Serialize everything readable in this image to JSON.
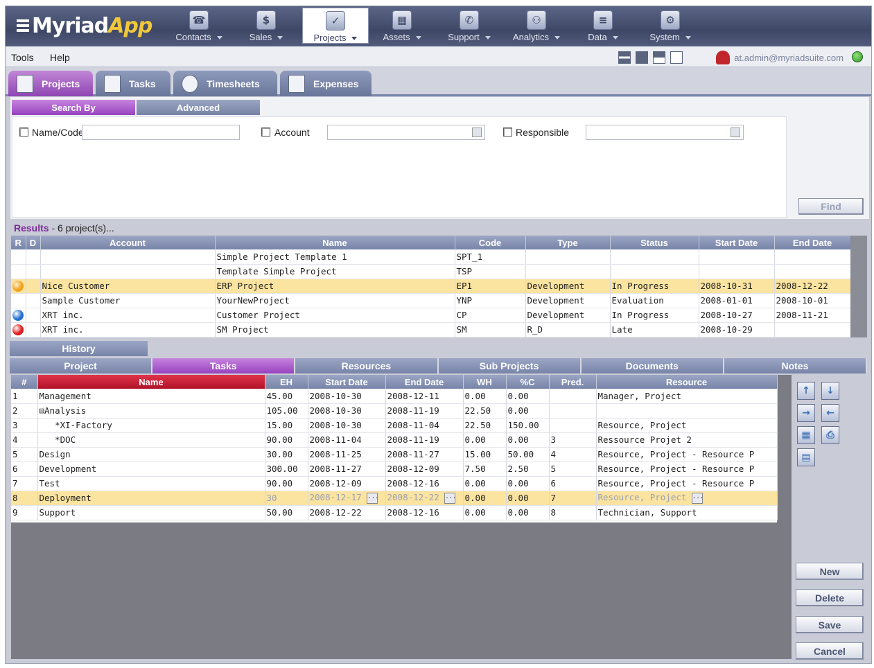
{
  "app": {
    "logo_part1": "Myriad",
    "logo_part2": "App"
  },
  "nav": [
    {
      "label": "Contacts",
      "icon": "contacts-icon",
      "glyph": "☎"
    },
    {
      "label": "Sales",
      "icon": "sales-icon",
      "glyph": "$"
    },
    {
      "label": "Projects",
      "icon": "projects-icon",
      "glyph": "✓"
    },
    {
      "label": "Assets",
      "icon": "assets-icon",
      "glyph": "▦"
    },
    {
      "label": "Support",
      "icon": "support-icon",
      "glyph": "✆"
    },
    {
      "label": "Analytics",
      "icon": "analytics-icon",
      "glyph": "⚇"
    },
    {
      "label": "Data",
      "icon": "data-icon",
      "glyph": "≡"
    },
    {
      "label": "System",
      "icon": "system-icon",
      "glyph": "⚙"
    }
  ],
  "menu": {
    "tools": "Tools",
    "help": "Help"
  },
  "user": {
    "email": "at.admin@myriadsuite.com"
  },
  "module_tabs": [
    "Projects",
    "Tasks",
    "Timesheets",
    "Expenses"
  ],
  "search": {
    "tab_search_by": "Search By",
    "tab_advanced": "Advanced",
    "name_code_label": "Name/Code",
    "account_label": "Account",
    "responsible_label": "Responsible",
    "find_button": "Find"
  },
  "results": {
    "label": "Results",
    "count_text": "6 project(s)...",
    "columns": [
      "R",
      "D",
      "Account",
      "Name",
      "Code",
      "Type",
      "Status",
      "Start Date",
      "End Date"
    ],
    "rows": [
      {
        "status_color": "",
        "account": "",
        "name": "Simple Project Template 1",
        "code": "SPT_1",
        "type": "",
        "status": "",
        "start": "",
        "end": ""
      },
      {
        "status_color": "",
        "account": "",
        "name": "Template Simple Project",
        "code": "TSP",
        "type": "",
        "status": "",
        "start": "",
        "end": ""
      },
      {
        "status_color": "#f0a21c",
        "account": "Nice Customer",
        "name": "ERP Project",
        "code": "EP1",
        "type": "Development",
        "status": "In Progress",
        "start": "2008-10-31",
        "end": "2008-12-22",
        "selected": true
      },
      {
        "status_color": "",
        "account": "Sample Customer",
        "name": "YourNewProject",
        "code": "YNP",
        "type": "Development",
        "status": "Evaluation",
        "start": "2008-01-01",
        "end": "2008-10-01"
      },
      {
        "status_color": "#1f6fd1",
        "account": "XRT inc.",
        "name": "Customer Project",
        "code": "CP",
        "type": "Development",
        "status": "In Progress",
        "start": "2008-10-27",
        "end": "2008-11-21"
      },
      {
        "status_color": "#e11b1b",
        "account": "XRT inc.",
        "name": "SM Project",
        "code": "SM",
        "type": "R_D",
        "status": "Late",
        "start": "2008-10-29",
        "end": ""
      }
    ]
  },
  "history": {
    "label": "History"
  },
  "sub_tabs": [
    "Project",
    "Tasks",
    "Resources",
    "Sub Projects",
    "Documents",
    "Notes"
  ],
  "tasks": {
    "columns": [
      "#",
      "Name",
      "EH",
      "Start Date",
      "End Date",
      "WH",
      "%C",
      "Pred.",
      "Resource"
    ],
    "rows": [
      {
        "num": "1",
        "name": "Management",
        "eh": "45.00",
        "start": "2008-10-30",
        "end": "2008-12-11",
        "wh": "0.00",
        "pc": "0.00",
        "pred": "",
        "resource": "Manager, Project"
      },
      {
        "num": "2",
        "name": "⊟Analysis",
        "eh": "105.00",
        "start": "2008-10-30",
        "end": "2008-11-19",
        "wh": "22.50",
        "pc": "0.00",
        "pred": "",
        "resource": ""
      },
      {
        "num": "3",
        "name": "   *XI-Factory",
        "eh": "15.00",
        "start": "2008-10-30",
        "end": "2008-11-04",
        "wh": "22.50",
        "pc": "150.00",
        "pred": "",
        "resource": "Resource, Project"
      },
      {
        "num": "4",
        "name": "   *DOC",
        "eh": "90.00",
        "start": "2008-11-04",
        "end": "2008-11-19",
        "wh": "0.00",
        "pc": "0.00",
        "pred": "3",
        "resource": "Ressource Projet 2"
      },
      {
        "num": "5",
        "name": "Design",
        "eh": "30.00",
        "start": "2008-11-25",
        "end": "2008-11-27",
        "wh": "15.00",
        "pc": "50.00",
        "pred": "4",
        "resource": "Resource, Project - Resource P"
      },
      {
        "num": "6",
        "name": "Development",
        "eh": "300.00",
        "start": "2008-11-27",
        "end": "2008-12-09",
        "wh": "7.50",
        "pc": "2.50",
        "pred": "5",
        "resource": "Resource, Project - Resource P"
      },
      {
        "num": "7",
        "name": "Test",
        "eh": "90.00",
        "start": "2008-12-09",
        "end": "2008-12-16",
        "wh": "0.00",
        "pc": "0.00",
        "pred": "6",
        "resource": "Resource, Project - Resource P"
      },
      {
        "num": "8",
        "name": "Deployment",
        "eh": "30",
        "start": "2008-12-17",
        "end": "2008-12-22",
        "wh": "0.00",
        "pc": "0.00",
        "pred": "7",
        "resource": "Resource, Project",
        "editing": true
      },
      {
        "num": "9",
        "name": "Support",
        "eh": "50.00",
        "start": "2008-12-22",
        "end": "2008-12-16",
        "wh": "0.00",
        "pc": "0.00",
        "pred": "8",
        "resource": "Technician, Support"
      }
    ]
  },
  "actions": {
    "new": "New",
    "delete": "Delete",
    "save": "Save",
    "cancel": "Cancel"
  }
}
